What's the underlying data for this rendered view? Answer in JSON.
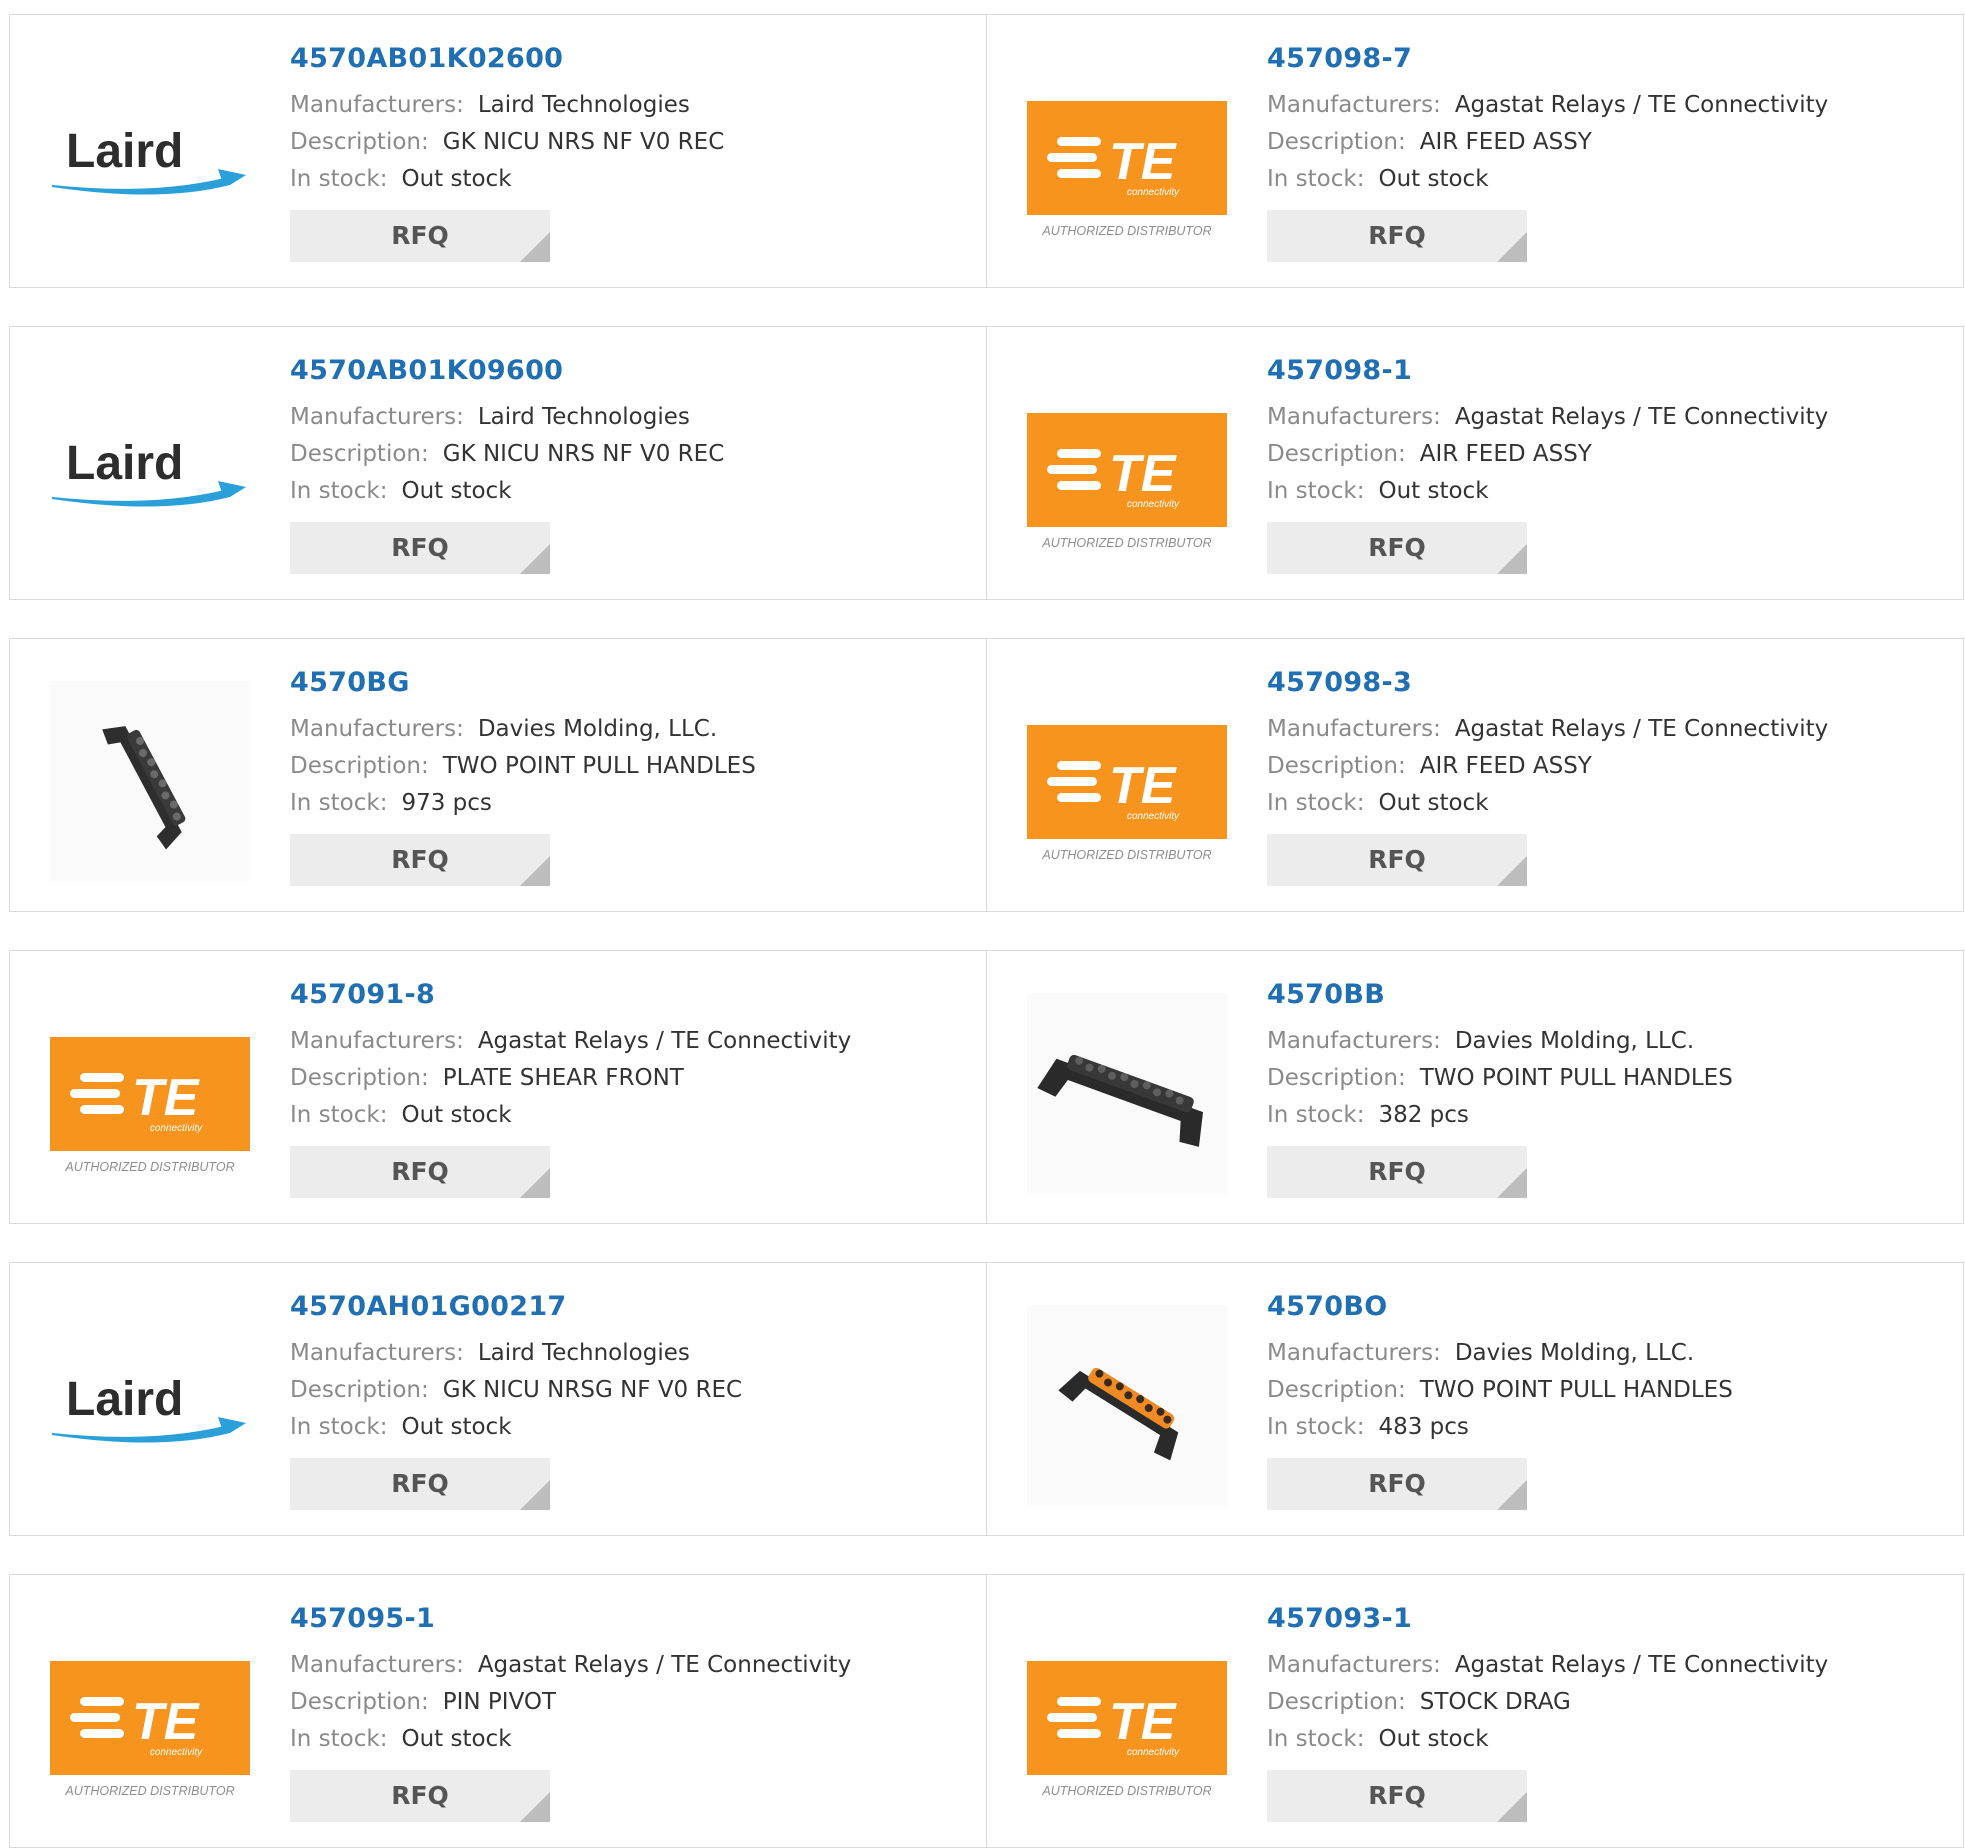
{
  "labels": {
    "manufacturer": "Manufacturers:",
    "description": "Description:",
    "stock": "In stock:",
    "rfq": "RFQ"
  },
  "logos": {
    "laird": {
      "text": "Laird"
    },
    "te": {
      "text": "TE",
      "sub": "connectivity",
      "caption": "AUTHORIZED DISTRIBUTOR"
    }
  },
  "colors": {
    "link": "#1f6fb2",
    "te_orange": "#f7941d",
    "laird_blue": "#2b9fd9",
    "handle_accent": "#f08a24"
  },
  "products": [
    {
      "part": "4570AB01K02600",
      "manufacturer": "Laird Technologies",
      "description": "GK NICU NRS NF V0 REC",
      "stock": "Out stock",
      "image": "laird-logo"
    },
    {
      "part": "457098-7",
      "manufacturer": "Agastat Relays / TE Connectivity",
      "description": "AIR FEED ASSY",
      "stock": "Out stock",
      "image": "te-logo"
    },
    {
      "part": "4570AB01K09600",
      "manufacturer": "Laird Technologies",
      "description": "GK NICU NRS NF V0 REC",
      "stock": "Out stock",
      "image": "laird-logo"
    },
    {
      "part": "457098-1",
      "manufacturer": "Agastat Relays / TE Connectivity",
      "description": "AIR FEED ASSY",
      "stock": "Out stock",
      "image": "te-logo"
    },
    {
      "part": "4570BG",
      "manufacturer": "Davies Molding, LLC.",
      "description": "TWO POINT PULL HANDLES",
      "stock": "973 pcs",
      "image": "handle-tilted-black"
    },
    {
      "part": "457098-3",
      "manufacturer": "Agastat Relays / TE Connectivity",
      "description": "AIR FEED ASSY",
      "stock": "Out stock",
      "image": "te-logo"
    },
    {
      "part": "457091-8",
      "manufacturer": "Agastat Relays / TE Connectivity",
      "description": "PLATE SHEAR FRONT",
      "stock": "Out stock",
      "image": "te-logo"
    },
    {
      "part": "4570BB",
      "manufacturer": "Davies Molding, LLC.",
      "description": "TWO POINT PULL HANDLES",
      "stock": "382 pcs",
      "image": "handle-black"
    },
    {
      "part": "4570AH01G00217",
      "manufacturer": "Laird Technologies",
      "description": "GK NICU NRSG NF V0 REC",
      "stock": "Out stock",
      "image": "laird-logo"
    },
    {
      "part": "4570BO",
      "manufacturer": "Davies Molding, LLC.",
      "description": "TWO POINT PULL HANDLES",
      "stock": "483 pcs",
      "image": "handle-orange"
    },
    {
      "part": "457095-1",
      "manufacturer": "Agastat Relays / TE Connectivity",
      "description": "PIN PIVOT",
      "stock": "Out stock",
      "image": "te-logo"
    },
    {
      "part": "457093-1",
      "manufacturer": "Agastat Relays / TE Connectivity",
      "description": "STOCK DRAG",
      "stock": "Out stock",
      "image": "te-logo"
    }
  ]
}
